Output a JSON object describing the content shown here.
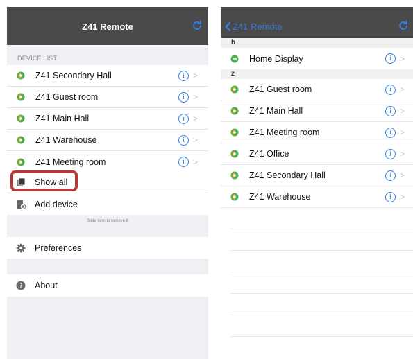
{
  "left_screen": {
    "nav": {
      "title": "Z41 Remote",
      "refresh_icon": "refresh-icon"
    },
    "section_header": "DEVICE LIST",
    "devices": [
      {
        "label": "Z41 Secondary Hall",
        "info": "i",
        "chevron": ">"
      },
      {
        "label": "Z41 Guest room",
        "info": "i",
        "chevron": ">"
      },
      {
        "label": "Z41 Main Hall",
        "info": "i",
        "chevron": ">"
      },
      {
        "label": "Z41 Warehouse",
        "info": "i",
        "chevron": ">"
      },
      {
        "label": "Z41 Meeting room",
        "info": "i",
        "chevron": ">"
      }
    ],
    "actions": {
      "show_all": "Show all",
      "add_device": "Add device"
    },
    "hint": "Slide item to remove it",
    "preferences": "Preferences",
    "about": "About"
  },
  "right_screen": {
    "nav": {
      "back_label": "Z41 Remote",
      "refresh_icon": "refresh-icon"
    },
    "sections": [
      {
        "header": "h",
        "items": [
          {
            "label": "Home Display",
            "info": "i",
            "chevron": ">"
          }
        ]
      },
      {
        "header": "z",
        "items": [
          {
            "label": "Z41 Guest room",
            "info": "i",
            "chevron": ">"
          },
          {
            "label": "Z41 Main Hall",
            "info": "i",
            "chevron": ">"
          },
          {
            "label": "Z41 Meeting room",
            "info": "i",
            "chevron": ">"
          },
          {
            "label": "Z41 Office",
            "info": "i",
            "chevron": ">"
          },
          {
            "label": "Z41 Secondary Hall",
            "info": "i",
            "chevron": ">"
          },
          {
            "label": "Z41 Warehouse",
            "info": "i",
            "chevron": ">"
          }
        ]
      }
    ]
  },
  "colors": {
    "nav_background": "#4a4a4a",
    "accent": "#2f80ed",
    "device_green": "#4caf50",
    "device_orange": "#f5a623",
    "highlight": "#b23a3a"
  }
}
